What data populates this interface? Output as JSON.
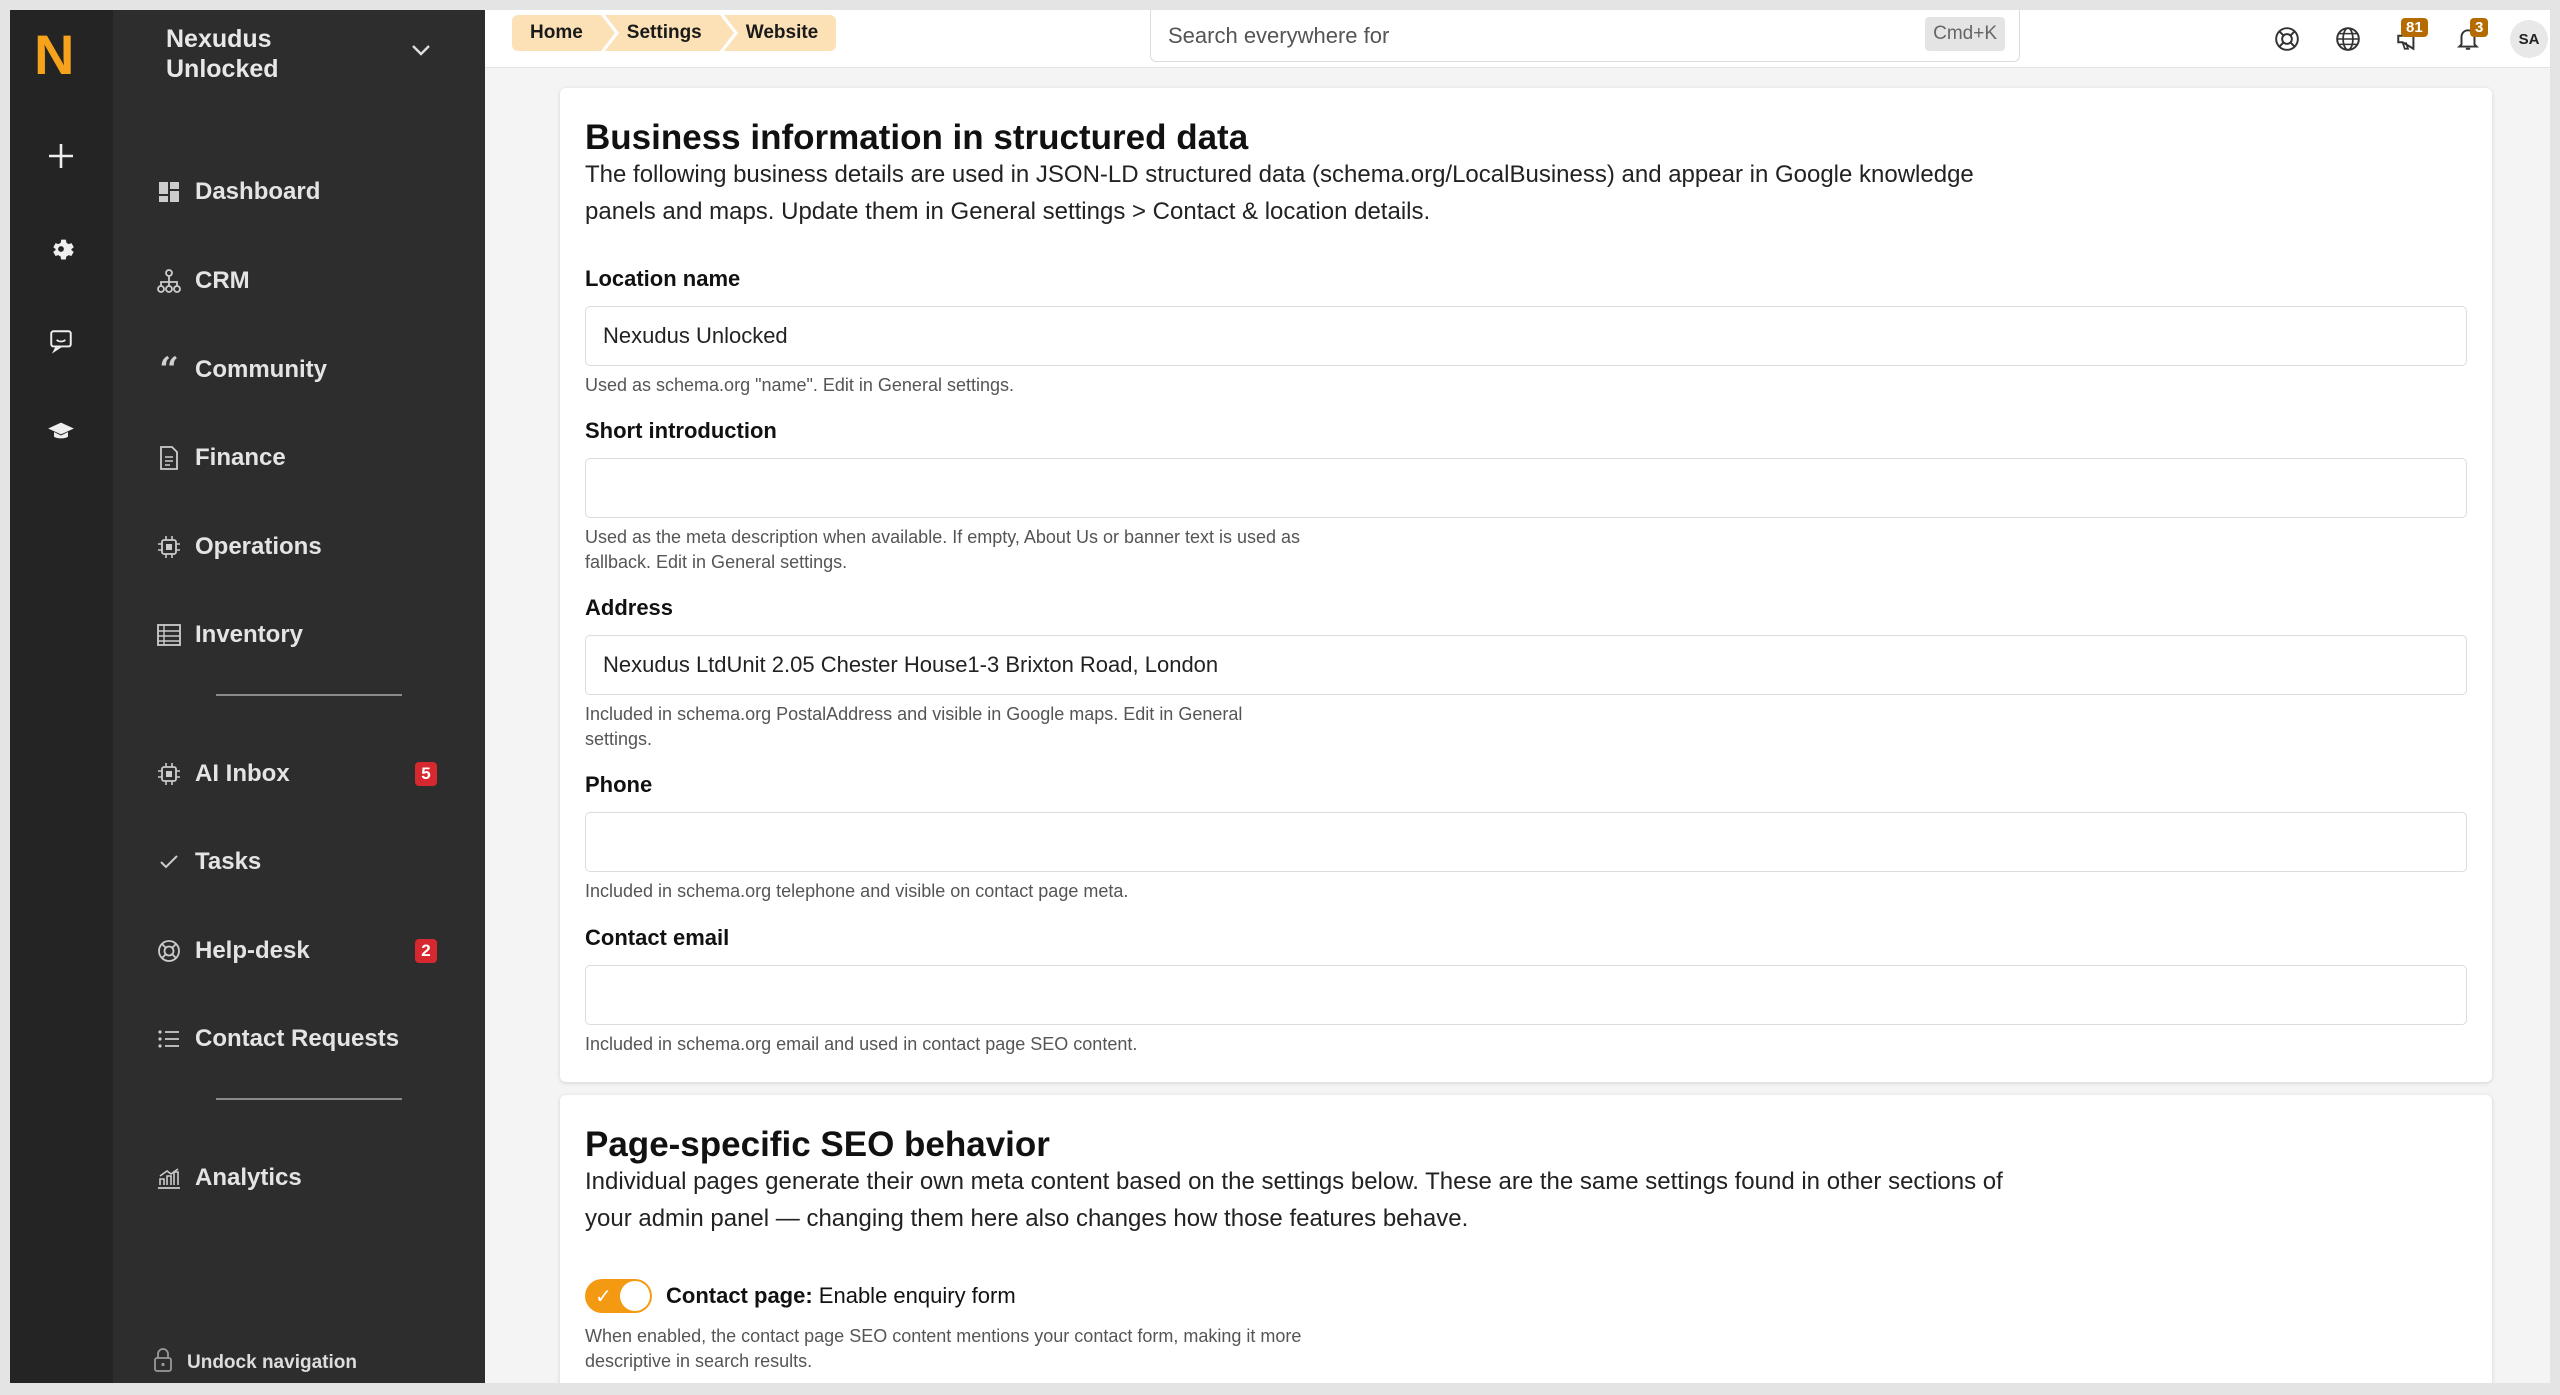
{
  "brand": {
    "logo": "N",
    "accent": "#f7a21b"
  },
  "rail": {
    "icons": [
      "plus-icon",
      "gear-icon",
      "chat-icon",
      "graduation-cap-icon"
    ]
  },
  "sidebar": {
    "org_name": "Nexudus Unlocked",
    "items": [
      {
        "label": "Dashboard",
        "icon": "dashboard-icon"
      },
      {
        "label": "CRM",
        "icon": "org-chart-icon"
      },
      {
        "label": "Community",
        "icon": "quote-icon"
      },
      {
        "label": "Finance",
        "icon": "document-icon"
      },
      {
        "label": "Operations",
        "icon": "chip-icon"
      },
      {
        "label": "Inventory",
        "icon": "table-icon"
      },
      {
        "label": "AI Inbox",
        "icon": "chip-icon",
        "badge": "5"
      },
      {
        "label": "Tasks",
        "icon": "check-icon"
      },
      {
        "label": "Help-desk",
        "icon": "lifebuoy-icon",
        "badge": "2"
      },
      {
        "label": "Contact Requests",
        "icon": "list-icon"
      },
      {
        "label": "Analytics",
        "icon": "chart-icon"
      }
    ],
    "undock_label": "Undock navigation"
  },
  "topbar": {
    "breadcrumbs": [
      "Home",
      "Settings",
      "Website"
    ],
    "search_placeholder": "Search everywhere for",
    "search_shortcut": "Cmd+K",
    "announcements_badge": "81",
    "notifications_badge": "3",
    "avatar_initials": "SA"
  },
  "business": {
    "title": "Business information in structured data",
    "intro": "The following business details are used in JSON-LD structured data (schema.org/LocalBusiness) and appear in Google knowledge panels and maps. Update them in General settings > Contact & location details.",
    "fields": [
      {
        "label": "Location name",
        "value": "Nexudus Unlocked",
        "help": "Used as schema.org \"name\". Edit in General settings."
      },
      {
        "label": "Short introduction",
        "value": "",
        "help": "Used as the meta description when available. If empty, About Us or banner text is used as fallback. Edit in General settings."
      },
      {
        "label": "Address",
        "value": "Nexudus LtdUnit 2.05 Chester House1-3 Brixton Road, London",
        "help": "Included in schema.org PostalAddress and visible in Google maps. Edit in General settings."
      },
      {
        "label": "Phone",
        "value": "",
        "help": "Included in schema.org telephone and visible on contact page meta."
      },
      {
        "label": "Contact email",
        "value": "",
        "help": "Included in schema.org email and used in contact page SEO content."
      }
    ]
  },
  "seo": {
    "title": "Page-specific SEO behavior",
    "intro": "Individual pages generate their own meta content based on the settings below. These are the same settings found in other sections of your admin panel — changing them here also changes how those features behave.",
    "toggle_label_bold": "Contact page:",
    "toggle_label_rest": " Enable enquiry form",
    "toggle_state": "on",
    "toggle_help": "When enabled, the contact page SEO content mentions your contact form, making it more descriptive in search results."
  }
}
